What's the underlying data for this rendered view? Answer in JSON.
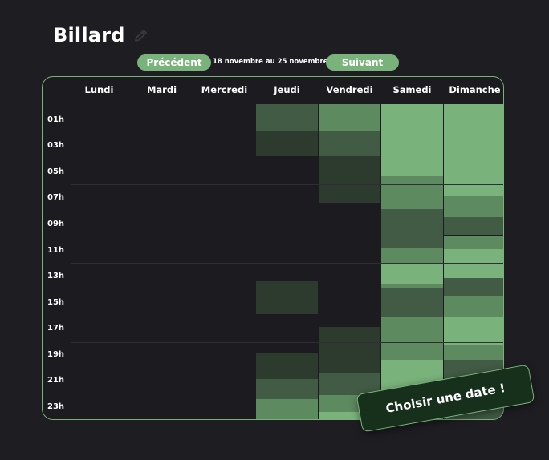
{
  "page": {
    "title": "Billard"
  },
  "nav": {
    "prev_label": "Précédent",
    "next_label": "Suivant",
    "range_label": "18 novembre au 25 novembre"
  },
  "calendar": {
    "days": [
      "Lundi",
      "Mardi",
      "Mercredi",
      "Jeudi",
      "Vendredi",
      "Samedi",
      "Dimanche"
    ],
    "hour_labels": [
      "01h",
      "03h",
      "05h",
      "07h",
      "09h",
      "11h",
      "13h",
      "15h",
      "17h",
      "19h",
      "21h",
      "23h"
    ],
    "colors": {
      "accent": "#7ab27b",
      "level_1": "#2d3b2f",
      "level_2": "#425b45",
      "level_3": "#5e8a60",
      "level_4": "#7ab27b"
    },
    "availability": [
      {
        "day": 3,
        "blocks": [
          {
            "start": 0,
            "end": 2,
            "level": 2
          },
          {
            "start": 2,
            "end": 4,
            "level": 1
          },
          {
            "start": 13.5,
            "end": 16,
            "level": 1
          },
          {
            "start": 19,
            "end": 21,
            "level": 1
          },
          {
            "start": 21,
            "end": 22.5,
            "level": 2
          },
          {
            "start": 22.5,
            "end": 24.5,
            "level": 3
          }
        ]
      },
      {
        "day": 4,
        "blocks": [
          {
            "start": 0,
            "end": 2,
            "level": 3
          },
          {
            "start": 2,
            "end": 4,
            "level": 2
          },
          {
            "start": 4,
            "end": 7.5,
            "level": 1
          },
          {
            "start": 17,
            "end": 18.5,
            "level": 1
          },
          {
            "start": 18.5,
            "end": 20.5,
            "level": 1
          },
          {
            "start": 20.5,
            "end": 22.2,
            "level": 2
          },
          {
            "start": 22.2,
            "end": 23.5,
            "level": 3
          },
          {
            "start": 23.5,
            "end": 24.5,
            "level": 4
          }
        ]
      },
      {
        "day": 5,
        "blocks": [
          {
            "start": 0,
            "end": 5.5,
            "level": 4
          },
          {
            "start": 5.5,
            "end": 8,
            "level": 3
          },
          {
            "start": 8,
            "end": 11,
            "level": 2
          },
          {
            "start": 11,
            "end": 12.2,
            "level": 3
          },
          {
            "start": 12.2,
            "end": 13.7,
            "level": 4
          },
          {
            "start": 13.7,
            "end": 14,
            "level": 3
          },
          {
            "start": 14,
            "end": 16.2,
            "level": 2
          },
          {
            "start": 16.2,
            "end": 17.8,
            "level": 3
          },
          {
            "start": 17.8,
            "end": 19.5,
            "level": 3
          },
          {
            "start": 19.5,
            "end": 24.5,
            "level": 4
          }
        ]
      },
      {
        "day": 6,
        "blocks": [
          {
            "start": 0,
            "end": 7,
            "level": 4
          },
          {
            "start": 7,
            "end": 8.6,
            "level": 3
          },
          {
            "start": 8.6,
            "end": 10,
            "level": 2
          },
          {
            "start": 10,
            "end": 11.1,
            "level": 3
          },
          {
            "start": 11.1,
            "end": 13.3,
            "level": 4
          },
          {
            "start": 13.3,
            "end": 14.6,
            "level": 2
          },
          {
            "start": 14.6,
            "end": 16.2,
            "level": 3
          },
          {
            "start": 16.2,
            "end": 18.4,
            "level": 4
          },
          {
            "start": 18.4,
            "end": 19.5,
            "level": 3
          },
          {
            "start": 19.5,
            "end": 24.5,
            "level": 2
          }
        ]
      }
    ]
  },
  "cta": {
    "label": "Choisir une date !"
  }
}
